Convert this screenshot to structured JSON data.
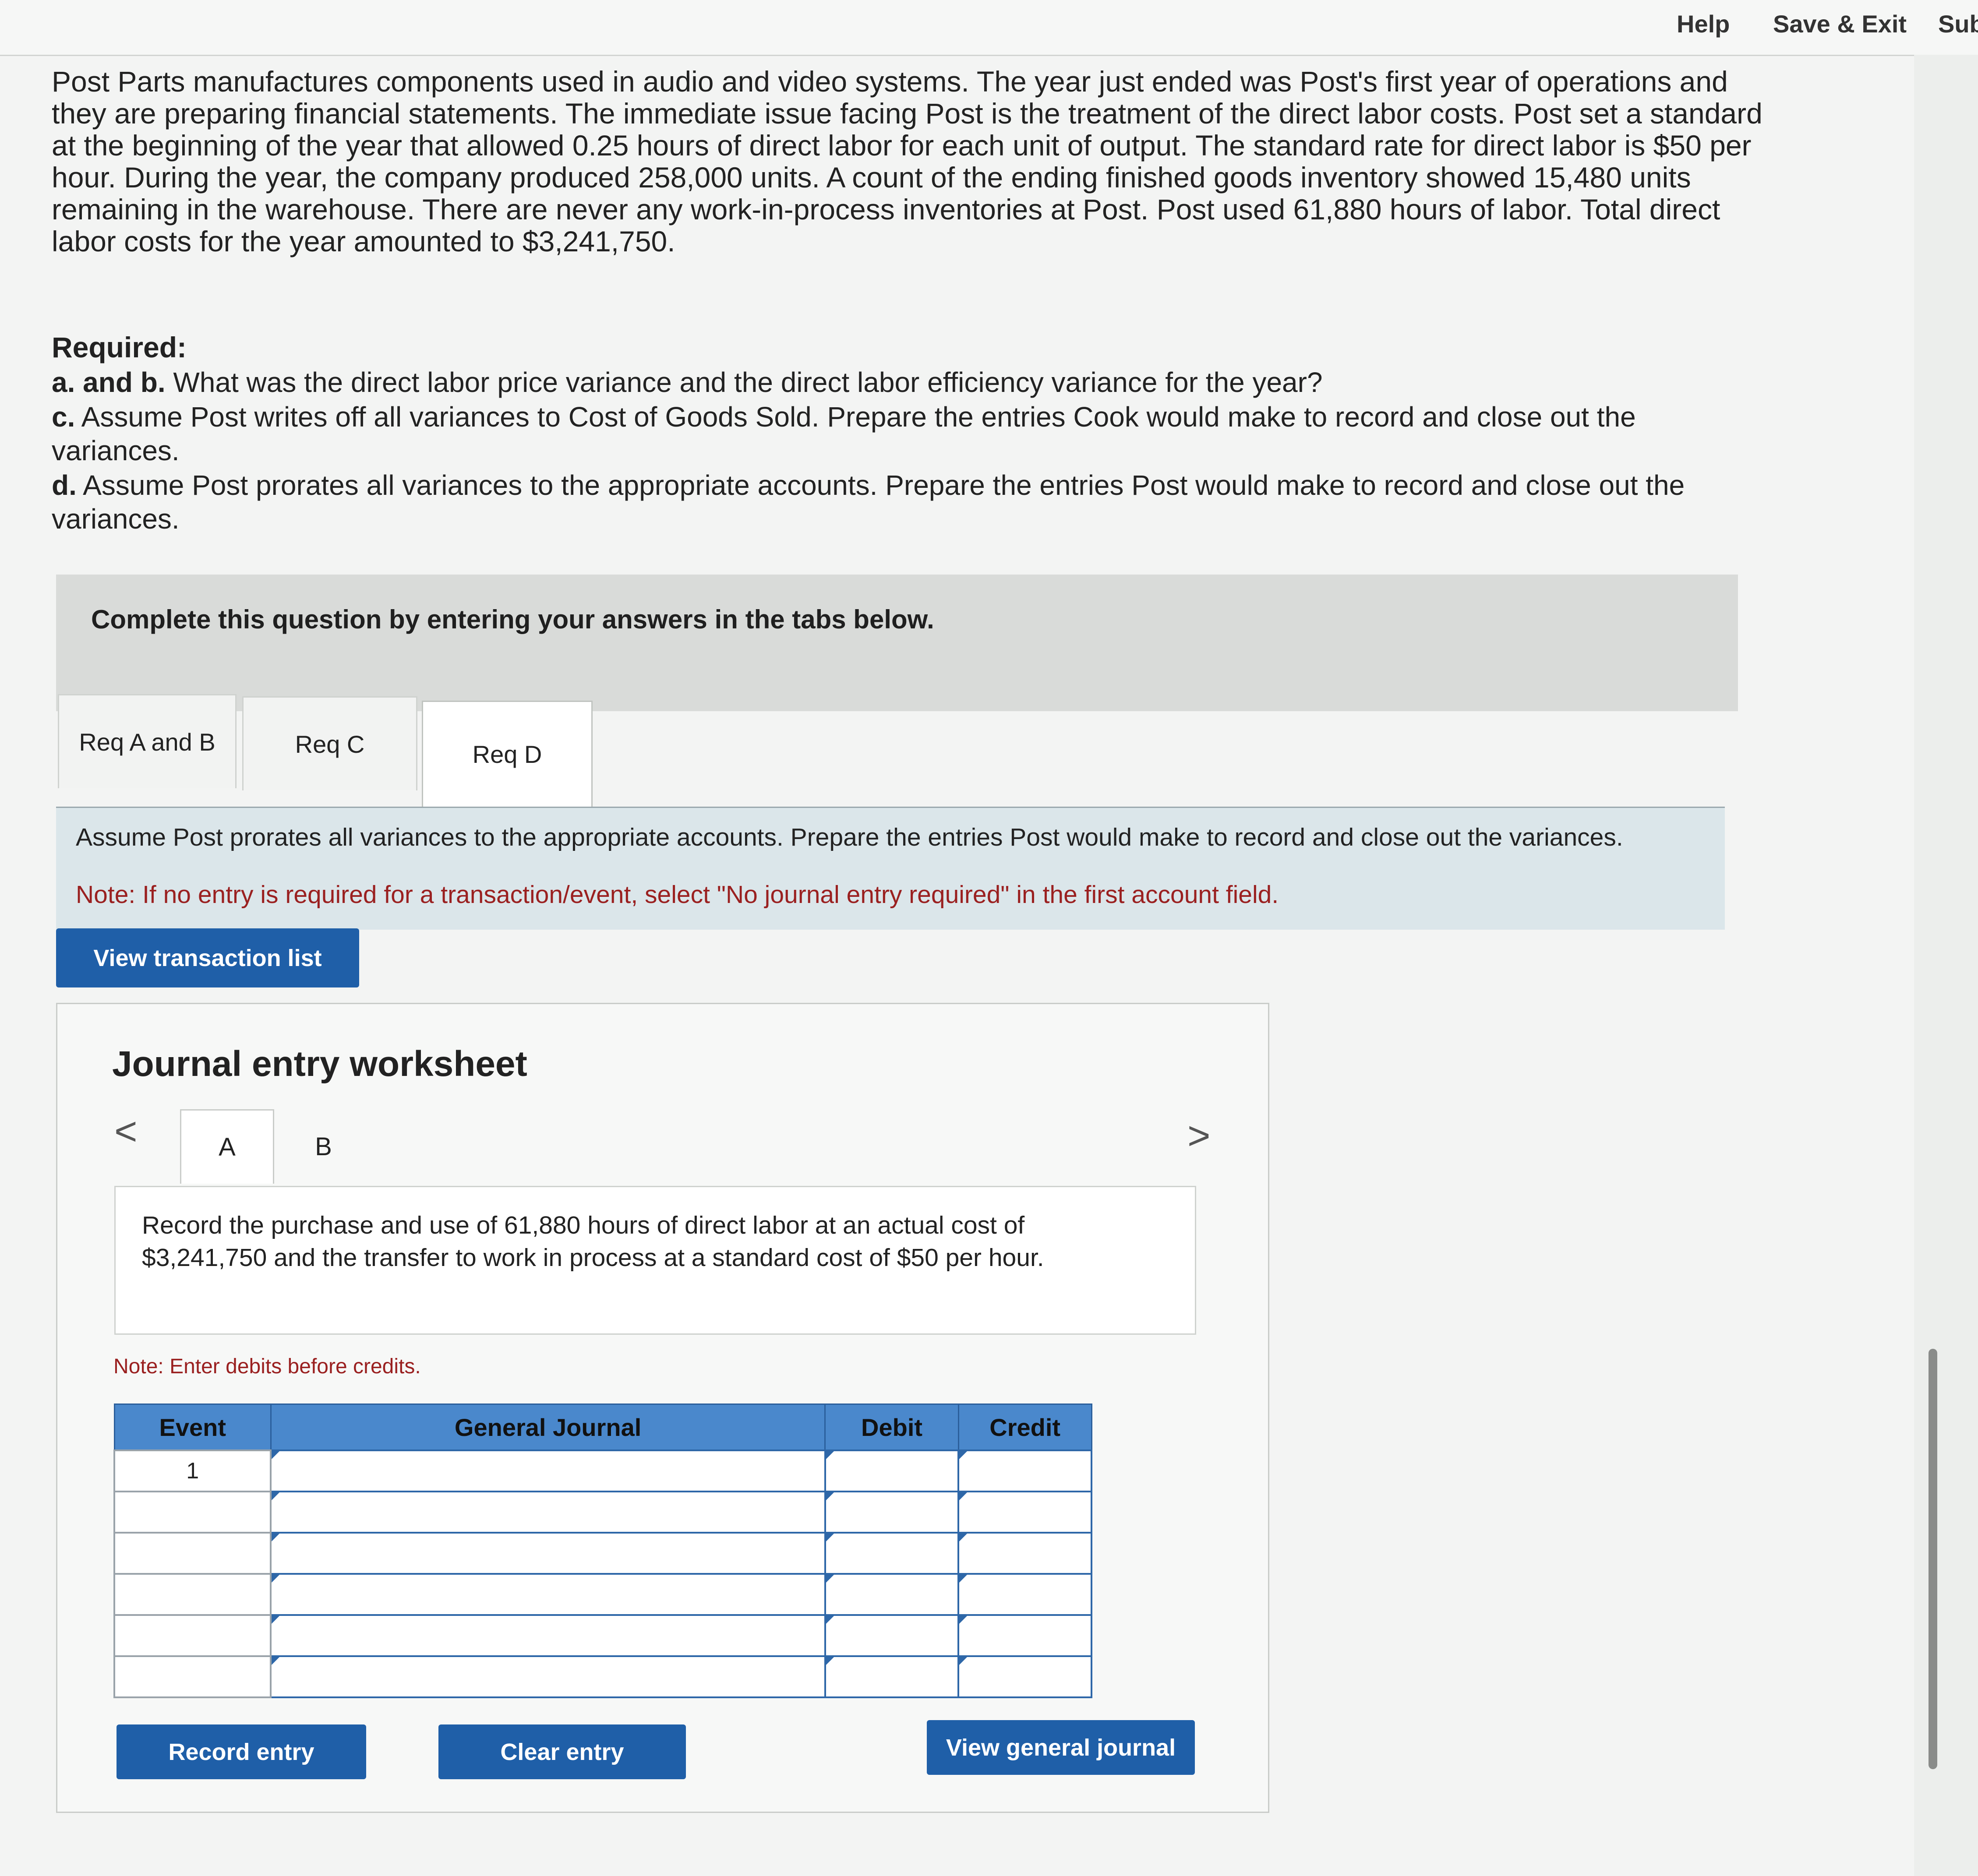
{
  "header": {
    "help_label": "Help",
    "save_exit_label": "Save & Exit",
    "submit_label": "Sub"
  },
  "problem_text": "Post Parts manufactures components used in audio and video systems. The year just ended was Post's first year of operations and they are preparing financial statements. The immediate issue facing Post is the treatment of the direct labor costs. Post set a standard at the beginning of the year that allowed 0.25 hours of direct labor for each unit of output. The standard rate for direct labor is $50 per hour. During the year, the company produced 258,000 units. A count of the ending finished goods inventory showed 15,480 units remaining in the warehouse. There are never any work-in-process inventories at Post. Post used 61,880 hours of labor. Total direct labor costs for the year amounted to $3,241,750.",
  "required": {
    "title": "Required:",
    "items": [
      {
        "prefix": "a. and b.",
        "text": " What was the direct labor price variance and the direct labor efficiency variance for the year?"
      },
      {
        "prefix": "c.",
        "text": " Assume Post writes off all variances to Cost of Goods Sold. Prepare the entries Cook would make to record and close out the variances."
      },
      {
        "prefix": "d.",
        "text": " Assume Post prorates all variances to the appropriate accounts. Prepare the entries Post would make to record and close out the variances."
      }
    ]
  },
  "complete_text": "Complete this question by entering your answers in the tabs below.",
  "tabs": [
    {
      "label": "Req A and B"
    },
    {
      "label": "Req C"
    },
    {
      "label": "Req D"
    }
  ],
  "tab_content": {
    "instruction": "Assume Post prorates all variances to the appropriate accounts. Prepare the entries Post would make to record and close out the variances.",
    "note": "Note: If no entry is required for a transaction/event, select \"No journal entry required\" in the first account field."
  },
  "view_transaction_list_label": "View transaction list",
  "worksheet": {
    "title": "Journal entry worksheet",
    "prev_arrow": "<",
    "next_arrow": ">",
    "tabs": [
      "A",
      "B"
    ],
    "description": "Record the purchase and use of 61,880 hours of direct labor at an actual cost of $3,241,750 and the transfer to work in process at a standard cost of $50 per hour.",
    "note": "Note: Enter debits before credits.",
    "table": {
      "headers": [
        "Event",
        "General Journal",
        "Debit",
        "Credit"
      ],
      "rows": [
        {
          "event": "1"
        },
        {
          "event": ""
        },
        {
          "event": ""
        },
        {
          "event": ""
        },
        {
          "event": ""
        },
        {
          "event": ""
        }
      ]
    },
    "record_entry_label": "Record entry",
    "clear_entry_label": "Clear entry",
    "view_general_journal_label": "View general journal"
  }
}
